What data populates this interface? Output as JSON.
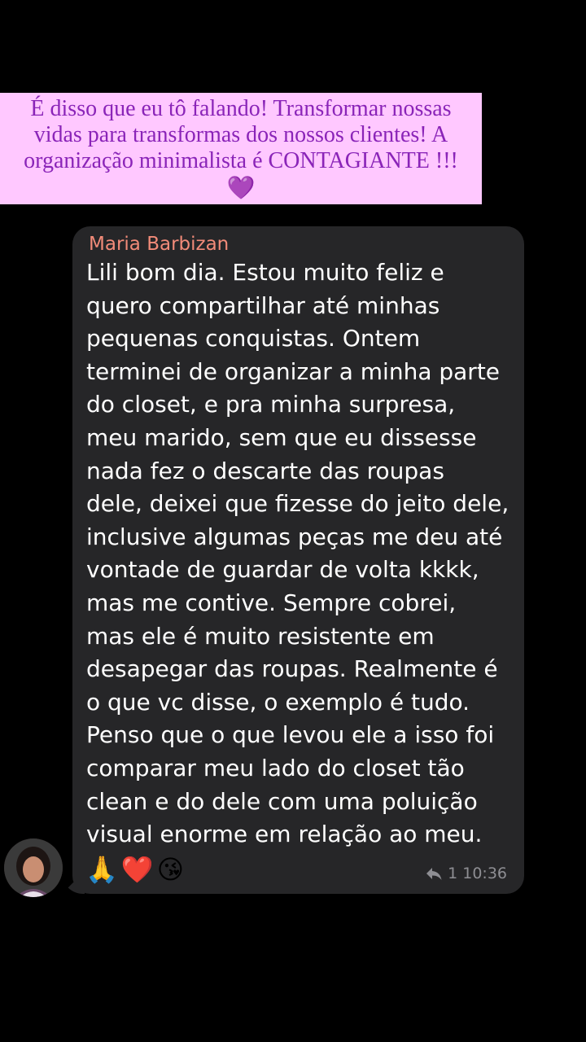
{
  "caption": {
    "lines": [
      "É disso que eu tô falando! Transformar nossas",
      "vidas para transformas dos nossos clientes! A",
      "organização minimalista é CONTAGIANTE !!!"
    ],
    "emoji": "💜"
  },
  "message": {
    "sender": "Maria Barbizan",
    "lines": [
      "Lili bom dia. Estou muito feliz e",
      "quero compartilhar até minhas",
      "pequenas conquistas. Ontem",
      "terminei de organizar a minha parte",
      "do closet, e pra minha surpresa,",
      "meu marido, sem que eu dissesse",
      "nada fez  o descarte das roupas",
      "dele, deixei que fizesse do jeito dele,",
      "inclusive algumas  peças me deu até",
      "vontade de guardar de volta kkkk,",
      "mas me contive. Sempre cobrei,",
      "mas ele é muito resistente em",
      "desapegar das roupas. Realmente é",
      "o que vc disse, o exemplo é tudo.",
      "Penso que o que levou ele a isso foi",
      "comparar meu lado do closet tão",
      "clean e do dele com uma poluição",
      "visual enorme em relação ao meu."
    ],
    "emojis": [
      "🙏",
      "❤️",
      "😘"
    ],
    "reply_count": "1",
    "time": "10:36",
    "reply_icon": "reply-arrow-icon"
  },
  "colors": {
    "background": "#000000",
    "caption_bg": "#ffc8ff",
    "caption_text": "#8a24b8",
    "bubble": "#262628",
    "sender": "#f28b79",
    "meta": "#8e8e93"
  }
}
